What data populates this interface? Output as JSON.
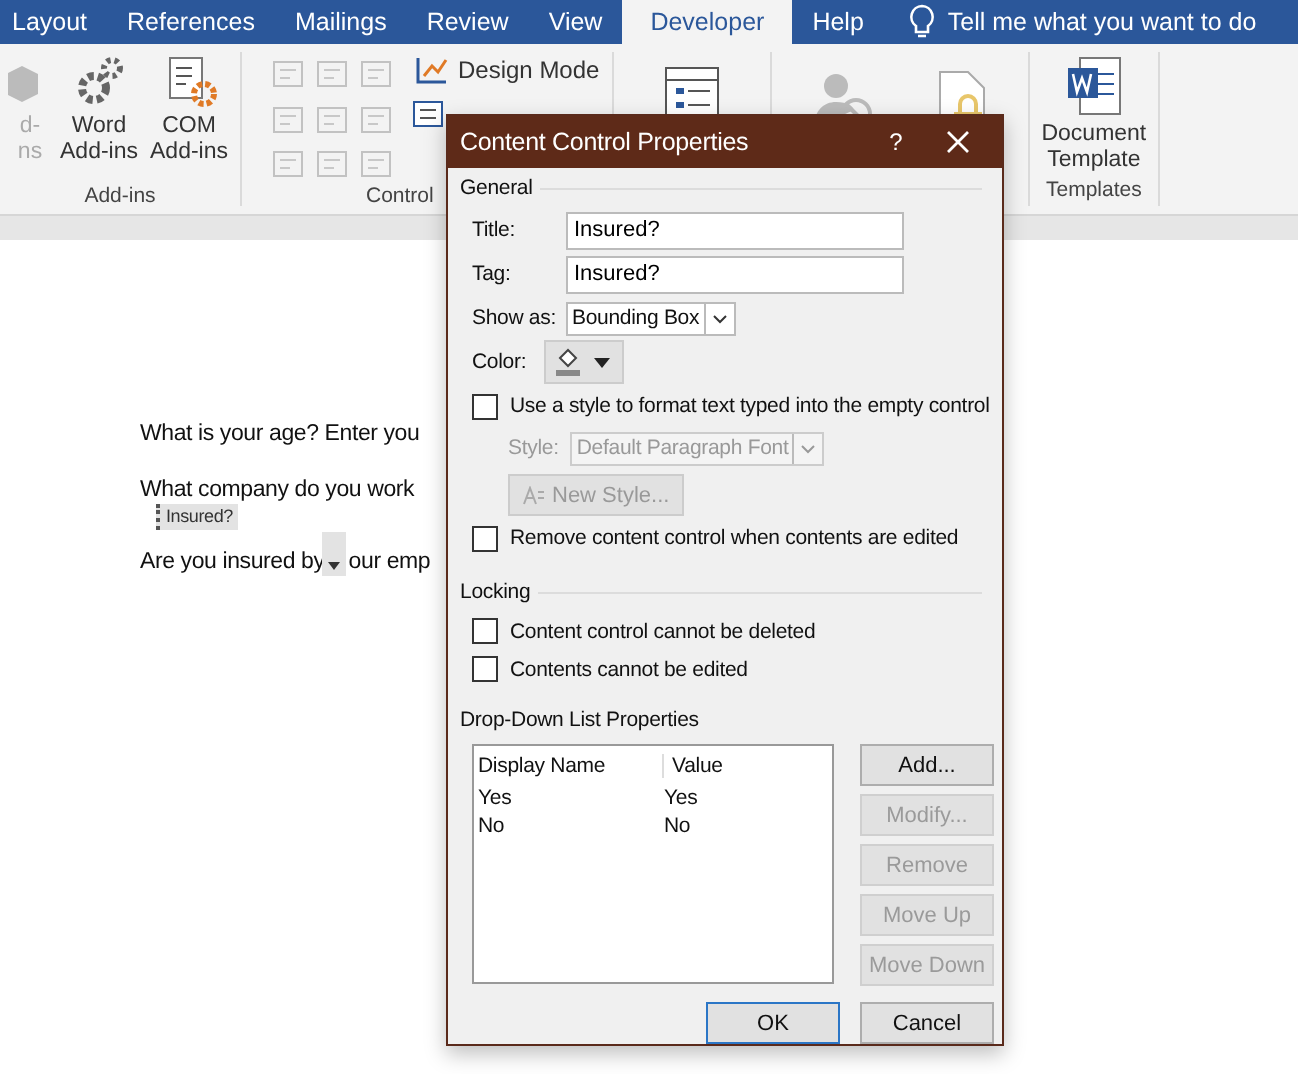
{
  "tabs": [
    {
      "label": "Layout",
      "selected": false
    },
    {
      "label": "References",
      "selected": false
    },
    {
      "label": "Mailings",
      "selected": false
    },
    {
      "label": "Review",
      "selected": false
    },
    {
      "label": "View",
      "selected": false
    },
    {
      "label": "Developer",
      "selected": true
    },
    {
      "label": "Help",
      "selected": false
    }
  ],
  "tell_me": "Tell me what you want to do",
  "ribbon": {
    "addins": {
      "label": "Add-ins",
      "buttons": [
        {
          "lines": [
            "d-",
            "ns"
          ],
          "disabled": true
        },
        {
          "lines": [
            "Word",
            "Add-ins"
          ],
          "disabled": false
        },
        {
          "lines": [
            "COM",
            "Add-ins"
          ],
          "disabled": false
        }
      ]
    },
    "controls": {
      "label": "Control",
      "design_mode": "Design Mode"
    },
    "templates": {
      "label": "Templates",
      "lines": [
        "Document",
        "Template"
      ]
    }
  },
  "document": [
    {
      "kind": "text",
      "text": "What is your age? Enter you"
    },
    {
      "kind": "text",
      "text": "What company do you work"
    },
    {
      "kind": "control",
      "before": "Are you insured by",
      "tag": "Insured?",
      "after": "our emp"
    }
  ],
  "dialog": {
    "title": "Content Control Properties",
    "help": "?",
    "general": {
      "heading": "General",
      "title_label": "Title:",
      "title_value": "Insured?",
      "tag_label": "Tag:",
      "tag_value": "Insured?",
      "show_as_label": "Show as:",
      "show_as_value": "Bounding Box",
      "color_label": "Color:",
      "use_style": {
        "label": "Use a style to format text typed into the empty control",
        "checked": false
      },
      "style_label": "Style:",
      "style_value": "Default Paragraph Font",
      "new_style": "New Style...",
      "remove": {
        "label": "Remove content control when contents are edited",
        "checked": false
      }
    },
    "locking": {
      "heading": "Locking",
      "options": [
        {
          "label": "Content control cannot be deleted",
          "checked": false
        },
        {
          "label": "Contents cannot be edited",
          "checked": false
        }
      ]
    },
    "dropdown": {
      "heading": "Drop-Down List Properties",
      "columns": [
        "Display Name",
        "Value"
      ],
      "rows": [
        [
          "Yes",
          "Yes"
        ],
        [
          "No",
          "No"
        ]
      ],
      "buttons": [
        {
          "label": "Add...",
          "disabled": false
        },
        {
          "label": "Modify...",
          "disabled": true
        },
        {
          "label": "Remove",
          "disabled": true
        },
        {
          "label": "Move Up",
          "disabled": true
        },
        {
          "label": "Move Down",
          "disabled": true
        }
      ]
    },
    "footer": [
      {
        "label": "OK",
        "default": true
      },
      {
        "label": "Cancel",
        "default": false
      }
    ]
  }
}
